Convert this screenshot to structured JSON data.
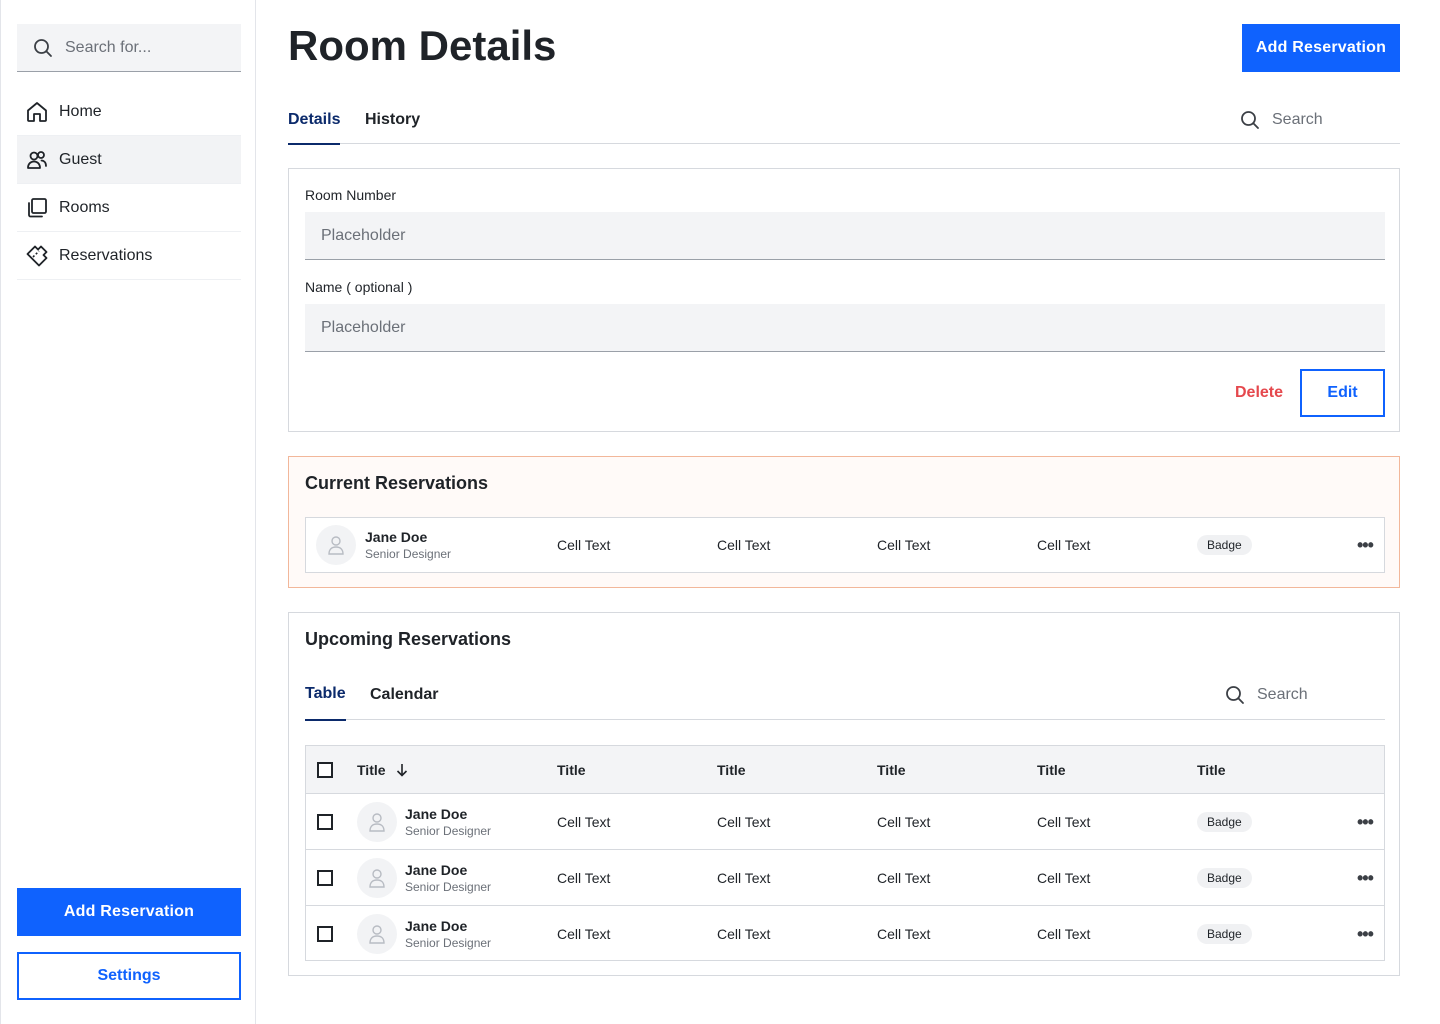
{
  "sidebar": {
    "search_placeholder": "Search for...",
    "items": [
      {
        "label": "Home",
        "icon": "home-icon"
      },
      {
        "label": "Guest",
        "icon": "users-icon"
      },
      {
        "label": "Rooms",
        "icon": "rooms-icon"
      },
      {
        "label": "Reservations",
        "icon": "ticket-icon"
      }
    ],
    "active_item": "Guest",
    "add_button": "Add Reservation",
    "settings_button": "Settings"
  },
  "header": {
    "title": "Room Details",
    "add_button": "Add Reservation"
  },
  "tabs": {
    "items": [
      "Details",
      "History"
    ],
    "active": "Details",
    "search_placeholder": "Search"
  },
  "details": {
    "room_number_label": "Room Number",
    "room_number_placeholder": "Placeholder",
    "name_label": "Name ( optional )",
    "name_placeholder": "Placeholder",
    "delete_button": "Delete",
    "edit_button": "Edit"
  },
  "current": {
    "title": "Current Reservations",
    "row": {
      "name": "Jane Doe",
      "role": "Senior Designer",
      "cells": [
        "Cell Text",
        "Cell Text",
        "Cell Text",
        "Cell Text"
      ],
      "badge": "Badge"
    }
  },
  "upcoming": {
    "title": "Upcoming Reservations",
    "tabs": [
      "Table",
      "Calendar"
    ],
    "active_tab": "Table",
    "search_placeholder": "Search",
    "columns": [
      "Title",
      "Title",
      "Title",
      "Title",
      "Title",
      "Title"
    ],
    "rows": [
      {
        "name": "Jane Doe",
        "role": "Senior Designer",
        "cells": [
          "Cell Text",
          "Cell Text",
          "Cell Text",
          "Cell Text"
        ],
        "badge": "Badge"
      },
      {
        "name": "Jane Doe",
        "role": "Senior Designer",
        "cells": [
          "Cell Text",
          "Cell Text",
          "Cell Text",
          "Cell Text"
        ],
        "badge": "Badge"
      },
      {
        "name": "Jane Doe",
        "role": "Senior Designer",
        "cells": [
          "Cell Text",
          "Cell Text",
          "Cell Text",
          "Cell Text"
        ],
        "badge": "Badge"
      }
    ]
  },
  "colors": {
    "primary": "#0f62fe",
    "active_tab": "#0b2a6b",
    "danger": "#e5484d",
    "highlight_border": "#f2b79a"
  }
}
